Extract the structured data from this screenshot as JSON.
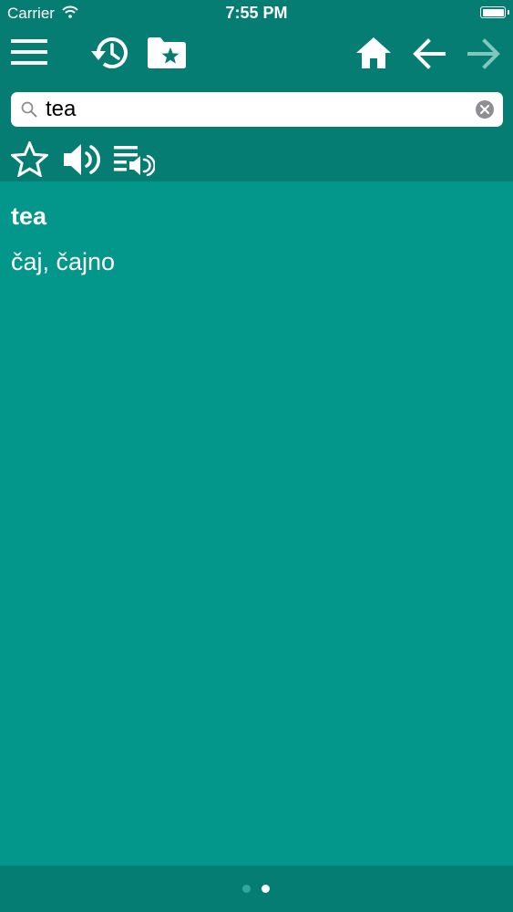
{
  "status_bar": {
    "carrier": "Carrier",
    "time": "7:55 PM"
  },
  "toolbar": {
    "icons": [
      "menu-icon",
      "history-icon",
      "favorites-folder-icon",
      "home-icon",
      "back-arrow-icon",
      "forward-arrow-icon"
    ]
  },
  "search": {
    "value": "tea",
    "placeholder": ""
  },
  "word_actions": {
    "icons": [
      "star-icon",
      "speaker-icon",
      "playlist-audio-icon"
    ]
  },
  "entry": {
    "headword": "tea",
    "translation": "čaj, čajno"
  },
  "pager": {
    "page_count": 2,
    "current_page": 2
  },
  "colors": {
    "background": "#03968a",
    "bar": "#067d73",
    "text": "#ffffff",
    "disabled_icon": "#7dc7bf"
  }
}
